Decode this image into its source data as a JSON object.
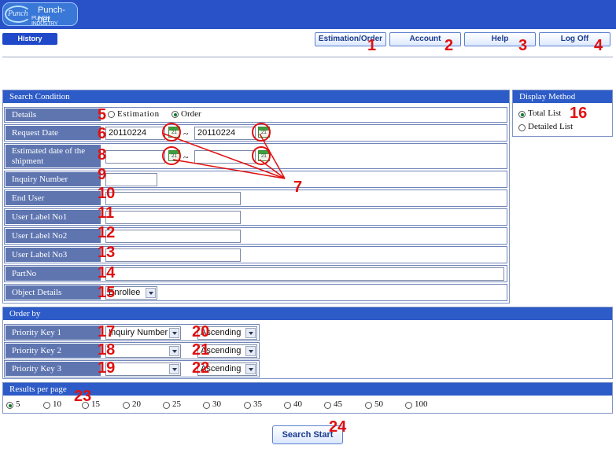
{
  "header": {
    "logo_prefix": "Punch",
    "logo_title": "Punch-net",
    "logo_subtitle": "PUNCH INDUSTRY"
  },
  "history_tab": "History",
  "nav": {
    "estimation_order": "Estimation/Order",
    "account": "Account",
    "help": "Help",
    "logoff": "Log Off"
  },
  "search_condition": {
    "title": "Search Condition",
    "details_label": "Details",
    "details_options": [
      "Estimation",
      "Order"
    ],
    "details_selected": "Order",
    "request_date_label": "Request Date",
    "request_date_from": "20110224",
    "request_date_to": "20110224",
    "range_sep": "~",
    "calendar_icon_text": "21",
    "estimated_shipment_label": "Estimated date of the shipment",
    "inquiry_number_label": "Inquiry Number",
    "end_user_label": "End User",
    "user_label_no1": "User Label No1",
    "user_label_no2": "User Label No2",
    "user_label_no3": "User Label No3",
    "part_no_label": "PartNo",
    "object_details_label": "Object Details",
    "object_details_value": "Enrollee"
  },
  "display_method": {
    "title": "Display Method",
    "options": [
      "Total List",
      "Detailed List"
    ],
    "selected": "Total List"
  },
  "order_by": {
    "title": "Order by",
    "key1_label": "Priority Key 1",
    "key2_label": "Priority Key 2",
    "key3_label": "Priority Key 3",
    "key1_value": "Inquiry Number",
    "key2_value": "",
    "key3_value": "",
    "dir1": "Ascending",
    "dir2": "Ascending",
    "dir3": "Ascending"
  },
  "results_per_page": {
    "title": "Results per page",
    "options": [
      "5",
      "10",
      "15",
      "20",
      "25",
      "30",
      "35",
      "40",
      "45",
      "50",
      "100"
    ],
    "selected": "5"
  },
  "search_button": "Search Start",
  "annotations": [
    "1",
    "2",
    "3",
    "4",
    "5",
    "6",
    "7",
    "8",
    "9",
    "10",
    "11",
    "12",
    "13",
    "14",
    "15",
    "16",
    "17",
    "18",
    "19",
    "20",
    "21",
    "22",
    "23",
    "24"
  ],
  "colors": {
    "header_blue": "#2a52c8",
    "section_blue": "#2d5bc7",
    "label_blue": "#5e75b0",
    "annotation_red": "#e01010"
  }
}
